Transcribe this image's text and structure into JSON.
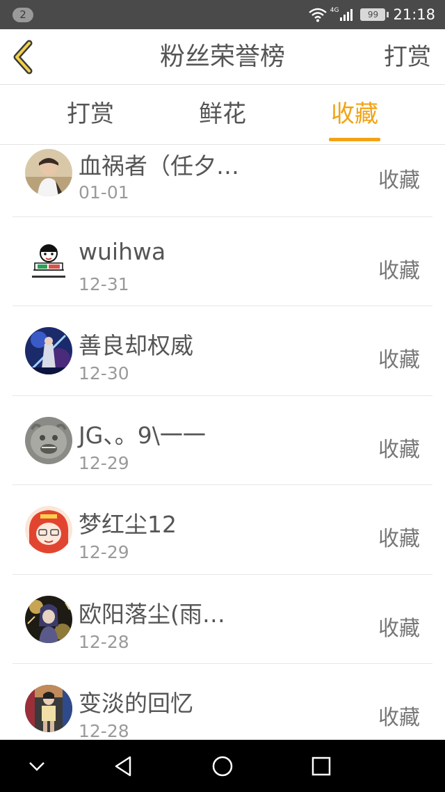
{
  "status_bar": {
    "notification_count": "2",
    "network": "4G",
    "battery": "99",
    "time": "21:18"
  },
  "header": {
    "title": "粉丝荣誉榜",
    "right_action": "打赏"
  },
  "tabs": [
    {
      "label": "打赏",
      "active": false
    },
    {
      "label": "鲜花",
      "active": false
    },
    {
      "label": "收藏",
      "active": true
    }
  ],
  "accent_color": "#f1a316",
  "list": [
    {
      "name": "血祸者（任夕…",
      "date": "01-01",
      "action": "收藏"
    },
    {
      "name": "wuihwa",
      "date": "12-31",
      "action": "收藏"
    },
    {
      "name": "善良却权威",
      "date": "12-30",
      "action": "收藏"
    },
    {
      "name": "JG、。9\\一一",
      "date": "12-29",
      "action": "收藏"
    },
    {
      "name": "梦红尘12",
      "date": "12-29",
      "action": "收藏"
    },
    {
      "name": "欧阳落尘(雨…",
      "date": "12-28",
      "action": "收藏"
    },
    {
      "name": "变淡的回忆",
      "date": "12-28",
      "action": "收藏"
    }
  ]
}
